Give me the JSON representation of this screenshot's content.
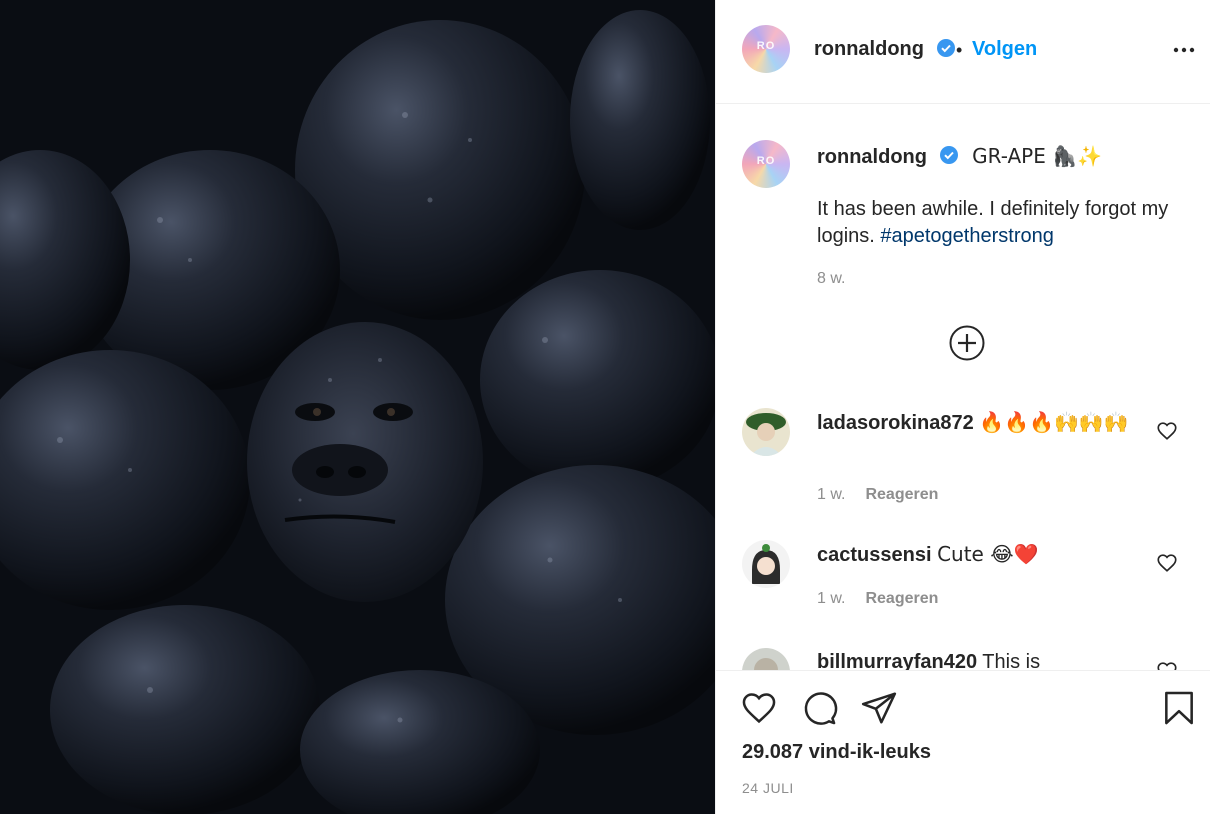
{
  "post": {
    "author": "ronnaldong",
    "follow_label": "Volgen",
    "dot": "•",
    "caption_title": "GR-APE 🦍✨",
    "caption_text": "It has been awhile. I definitely forgot my logins.",
    "hashtag": "#apetogetherstrong",
    "caption_time": "8 w.",
    "likes": "29.087 vind-ik-leuks",
    "date": "24 JULI"
  },
  "comments": [
    {
      "username": "ladasorokina872",
      "text": "🔥🔥🔥🙌🙌🙌",
      "time": "1 w.",
      "reply_label": "Reageren"
    },
    {
      "username": "cactussensi",
      "text": "Cute 😂❤️",
      "time": "1 w.",
      "reply_label": "Reageren"
    },
    {
      "username": "billmurrayfan420",
      "text": "This is"
    }
  ],
  "colors": {
    "accent": "#0095f6",
    "hashtag": "#00376b",
    "muted": "#8e8e8e",
    "verified": "#3897f0"
  },
  "icons": [
    "more-icon",
    "verified-icon",
    "add-comment-icon",
    "heart-icon",
    "comment-icon",
    "share-icon",
    "bookmark-icon"
  ]
}
